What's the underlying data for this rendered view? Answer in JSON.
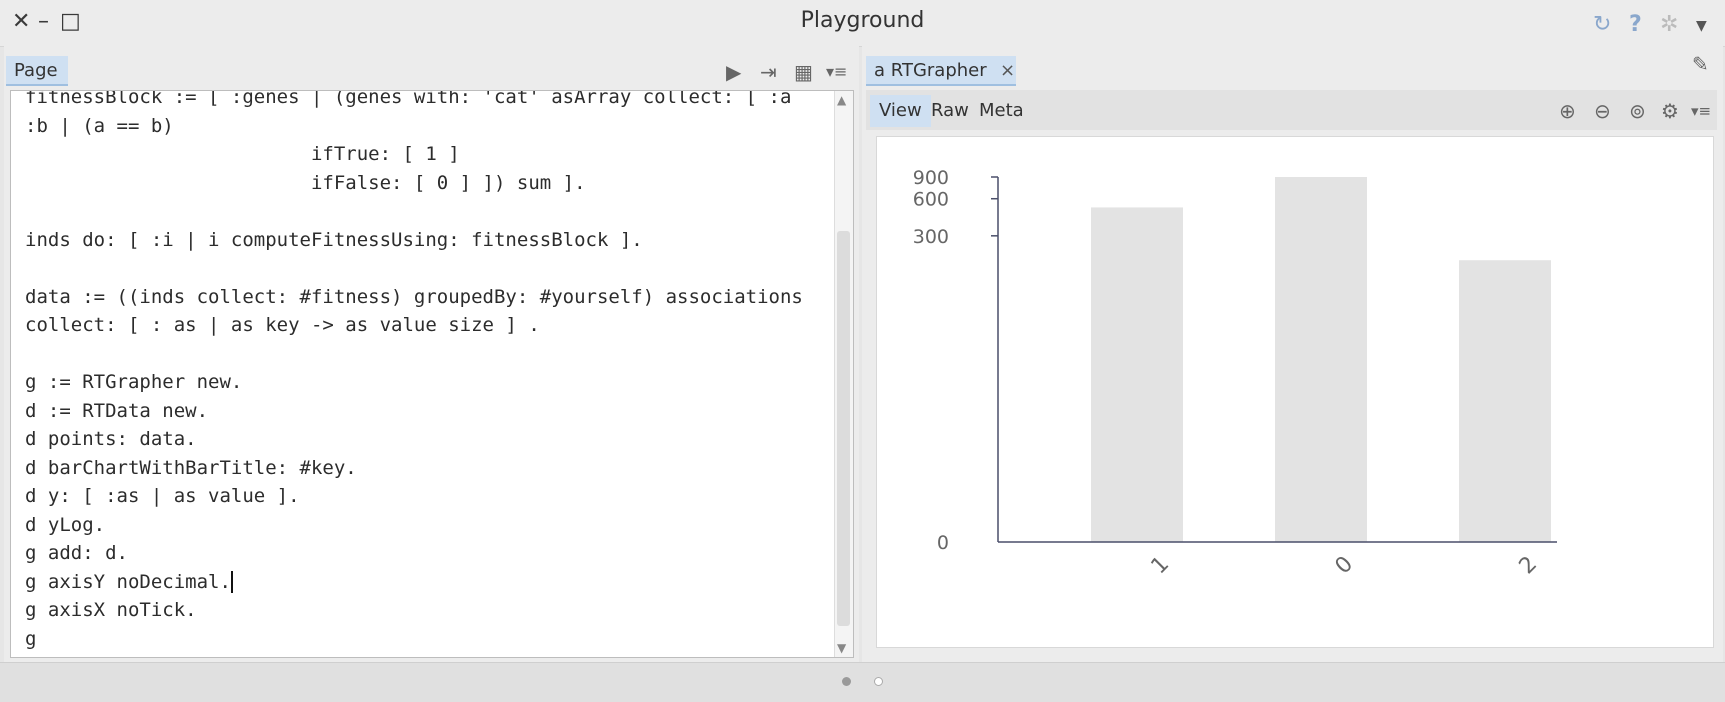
{
  "window": {
    "title": "Playground",
    "controls": [
      "close-icon",
      "minimize-icon",
      "maximize-icon"
    ],
    "right_icons": [
      "sync-icon",
      "help-icon",
      "settings-icon",
      "chevron-down-icon"
    ]
  },
  "left": {
    "tab_label": "Page",
    "toolbar": [
      "run-icon",
      "export-icon",
      "grid-icon",
      "menu-icon"
    ],
    "code_lines": [
      "fitnessBlock := [ :genes | (genes with: 'cat' asArray collect: [ :a",
      ":b | (a == b)",
      "                         ifTrue: [ 1 ]",
      "                         ifFalse: [ 0 ] ]) sum ].",
      "",
      "inds do: [ :i | i computeFitnessUsing: fitnessBlock ].",
      "",
      "data := ((inds collect: #fitness) groupedBy: #yourself) associations",
      "collect: [ : as | as key -> as value size ] .",
      "",
      "g := RTGrapher new.",
      "d := RTData new.",
      "d points: data.",
      "d barChartWithBarTitle: #key.",
      "d y: [ :as | as value ].",
      "d yLog.",
      "g add: d.",
      "g axisY noDecimal.",
      "g axisX noTick.",
      "g"
    ]
  },
  "right": {
    "tab_label": "a RTGrapher",
    "close_glyph": "×",
    "subtabs": [
      "View",
      "Raw",
      "Meta"
    ],
    "active_subtab": "View",
    "toolbar": [
      "zoom-in-icon",
      "zoom-out-icon",
      "zoom-fit-icon",
      "tools-icon",
      "menu-icon"
    ]
  },
  "chart_data": {
    "type": "bar",
    "categories": [
      "1",
      "0",
      "2"
    ],
    "values": [
      510,
      900,
      190
    ],
    "y_scale": "log",
    "y_ticks": [
      0,
      300,
      600,
      900
    ],
    "ylim": [
      0,
      900
    ],
    "grid": false,
    "bar_color": "#e3e3e3"
  },
  "colors": {
    "accent": "#cfe0f2",
    "bar": "#e3e3e3",
    "axis": "#4a4f6a"
  }
}
